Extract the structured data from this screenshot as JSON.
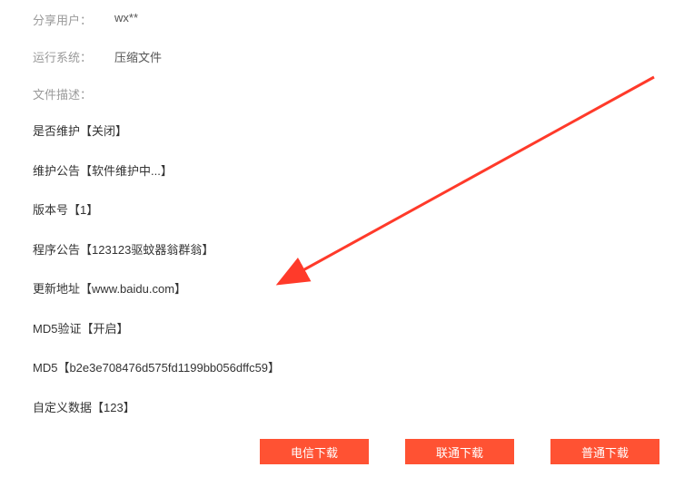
{
  "meta": {
    "shareUserLabel": "分享用户：",
    "shareUserValue": "wx**",
    "osLabel": "运行系统：",
    "osValue": "压缩文件",
    "descLabel": "文件描述："
  },
  "description": {
    "maintenance": "是否维护【关闭】",
    "maintenanceNotice": "维护公告【软件维护中...】",
    "version": "版本号【1】",
    "programNotice": "程序公告【123123驱蚊器翁群翁】",
    "updateUrl": "更新地址【www.baidu.com】",
    "md5Verify": "MD5验证【开启】",
    "md5": "MD5【b2e3e708476d575fd1199bb056dffc59】",
    "customData": "自定义数据【123】"
  },
  "buttons": {
    "telecom": "电信下载",
    "unicom": "联通下载",
    "normal": "普通下载"
  },
  "colors": {
    "accent": "#ff5233",
    "arrow": "#ff3a2a"
  }
}
